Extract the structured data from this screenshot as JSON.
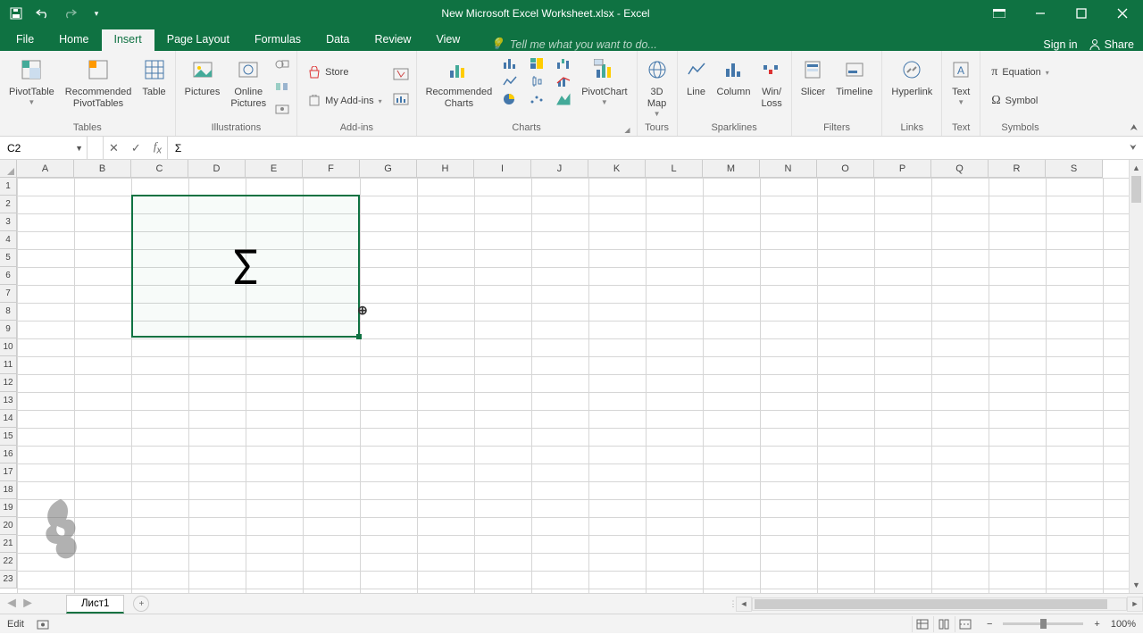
{
  "window": {
    "title": "New Microsoft Excel Worksheet.xlsx - Excel"
  },
  "tabs": {
    "file": "File",
    "home": "Home",
    "insert": "Insert",
    "page_layout": "Page Layout",
    "formulas": "Formulas",
    "data": "Data",
    "review": "Review",
    "view": "View",
    "tell_me": "Tell me what you want to do...",
    "sign_in": "Sign in",
    "share": "Share"
  },
  "ribbon": {
    "tables": {
      "label": "Tables",
      "pivot": "PivotTable",
      "rec_pivot": "Recommended\nPivotTables",
      "table": "Table"
    },
    "illustrations": {
      "label": "Illustrations",
      "pictures": "Pictures",
      "online": "Online\nPictures"
    },
    "addins": {
      "label": "Add-ins",
      "store": "Store",
      "my": "My Add-ins"
    },
    "charts": {
      "label": "Charts",
      "rec": "Recommended\nCharts",
      "pivot_chart": "PivotChart"
    },
    "tours": {
      "label": "Tours",
      "map": "3D\nMap"
    },
    "sparklines": {
      "label": "Sparklines",
      "line": "Line",
      "column": "Column",
      "winloss": "Win/\nLoss"
    },
    "filters": {
      "label": "Filters",
      "slicer": "Slicer",
      "timeline": "Timeline"
    },
    "links": {
      "label": "Links",
      "hyperlink": "Hyperlink"
    },
    "text": {
      "label": "Text",
      "text": "Text"
    },
    "symbols": {
      "label": "Symbols",
      "equation": "Equation",
      "symbol": "Symbol"
    }
  },
  "formula_bar": {
    "name_box": "C2",
    "value": "Σ"
  },
  "columns": [
    "A",
    "B",
    "C",
    "D",
    "E",
    "F",
    "G",
    "H",
    "I",
    "J",
    "K",
    "L",
    "M",
    "N",
    "O",
    "P",
    "Q",
    "R",
    "S"
  ],
  "rows": [
    "1",
    "2",
    "3",
    "4",
    "5",
    "6",
    "7",
    "8",
    "9",
    "10",
    "11",
    "12",
    "13",
    "14",
    "15",
    "16",
    "17",
    "18",
    "19",
    "20",
    "21",
    "22",
    "23"
  ],
  "cell_value": "Σ",
  "sheet": {
    "name": "Лист1"
  },
  "status": {
    "mode": "Edit",
    "zoom": "100%"
  }
}
